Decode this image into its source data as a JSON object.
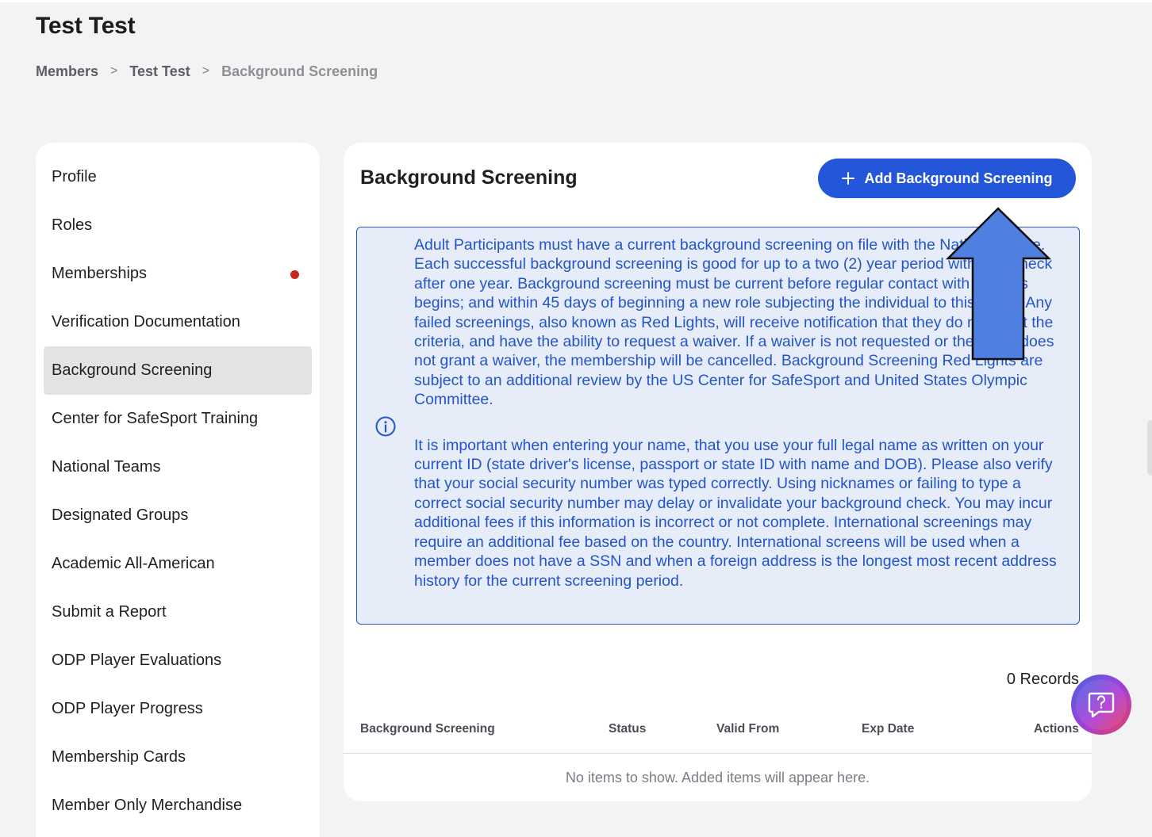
{
  "header": {
    "title": "Test Test",
    "breadcrumb": [
      "Members",
      "Test Test",
      "Background Screening"
    ],
    "separator": ">"
  },
  "sidebar": {
    "items": [
      {
        "label": "Profile"
      },
      {
        "label": "Roles"
      },
      {
        "label": "Memberships",
        "badge": "red-dot"
      },
      {
        "label": "Verification Documentation"
      },
      {
        "label": "Background Screening",
        "active": true
      },
      {
        "label": "Center for SafeSport Training"
      },
      {
        "label": "National Teams"
      },
      {
        "label": "Designated Groups"
      },
      {
        "label": "Academic All-American"
      },
      {
        "label": "Submit a Report"
      },
      {
        "label": "ODP Player Evaluations"
      },
      {
        "label": "ODP Player Progress"
      },
      {
        "label": "Membership Cards"
      },
      {
        "label": "Member Only Merchandise"
      }
    ]
  },
  "main": {
    "title": "Background Screening",
    "add_button_label": "Add Background Screening",
    "info": {
      "icon": "info-icon",
      "paragraph1": "Adult Participants must have a current background screening on file with the National Office. Each successful background screening is good for up to a two (2) year period with a re-check after one year. Background screening must be current before regular contact with athletes begins; and within 45 days of beginning a new role subjecting the individual to this policy. Any failed screenings, also known as Red Lights, will receive notification that they do not meet the criteria, and have the ability to request a waiver. If a waiver is not requested or the panel does not grant a waiver, the membership will be cancelled. Background Screening Red Lights are subject to an additional review by the US Center for SafeSport and United States Olympic Committee.",
      "paragraph2": "It is important when entering your name, that you use your full legal name as written on your current ID (state driver's license, passport or state ID with name and DOB). Please also verify that your social security number was typed correctly. Using nicknames or failing to type a correct social security number may delay or invalidate your background check. You may incur additional fees if this information is incorrect or not complete. International screenings may require an additional fee based on the country. International screens will be used when a member does not have a SSN and when a foreign address is the longest most recent address history for the current screening period."
    },
    "records_label": "0 Records",
    "table": {
      "columns": [
        "Background Screening",
        "Status",
        "Valid From",
        "Exp Date",
        "Actions"
      ],
      "rows": [],
      "empty_message": "No items to show. Added items will appear here."
    }
  },
  "colors": {
    "primary": "#2456d9",
    "info_text": "#2455c8",
    "info_bg": "#e6ecf8",
    "badge_red": "#c8251f",
    "overlay_arrow": "#4f7fe0"
  },
  "icons": {
    "add": "plus-icon",
    "help": "help-chat-icon",
    "overlay": "up-arrow-icon"
  }
}
